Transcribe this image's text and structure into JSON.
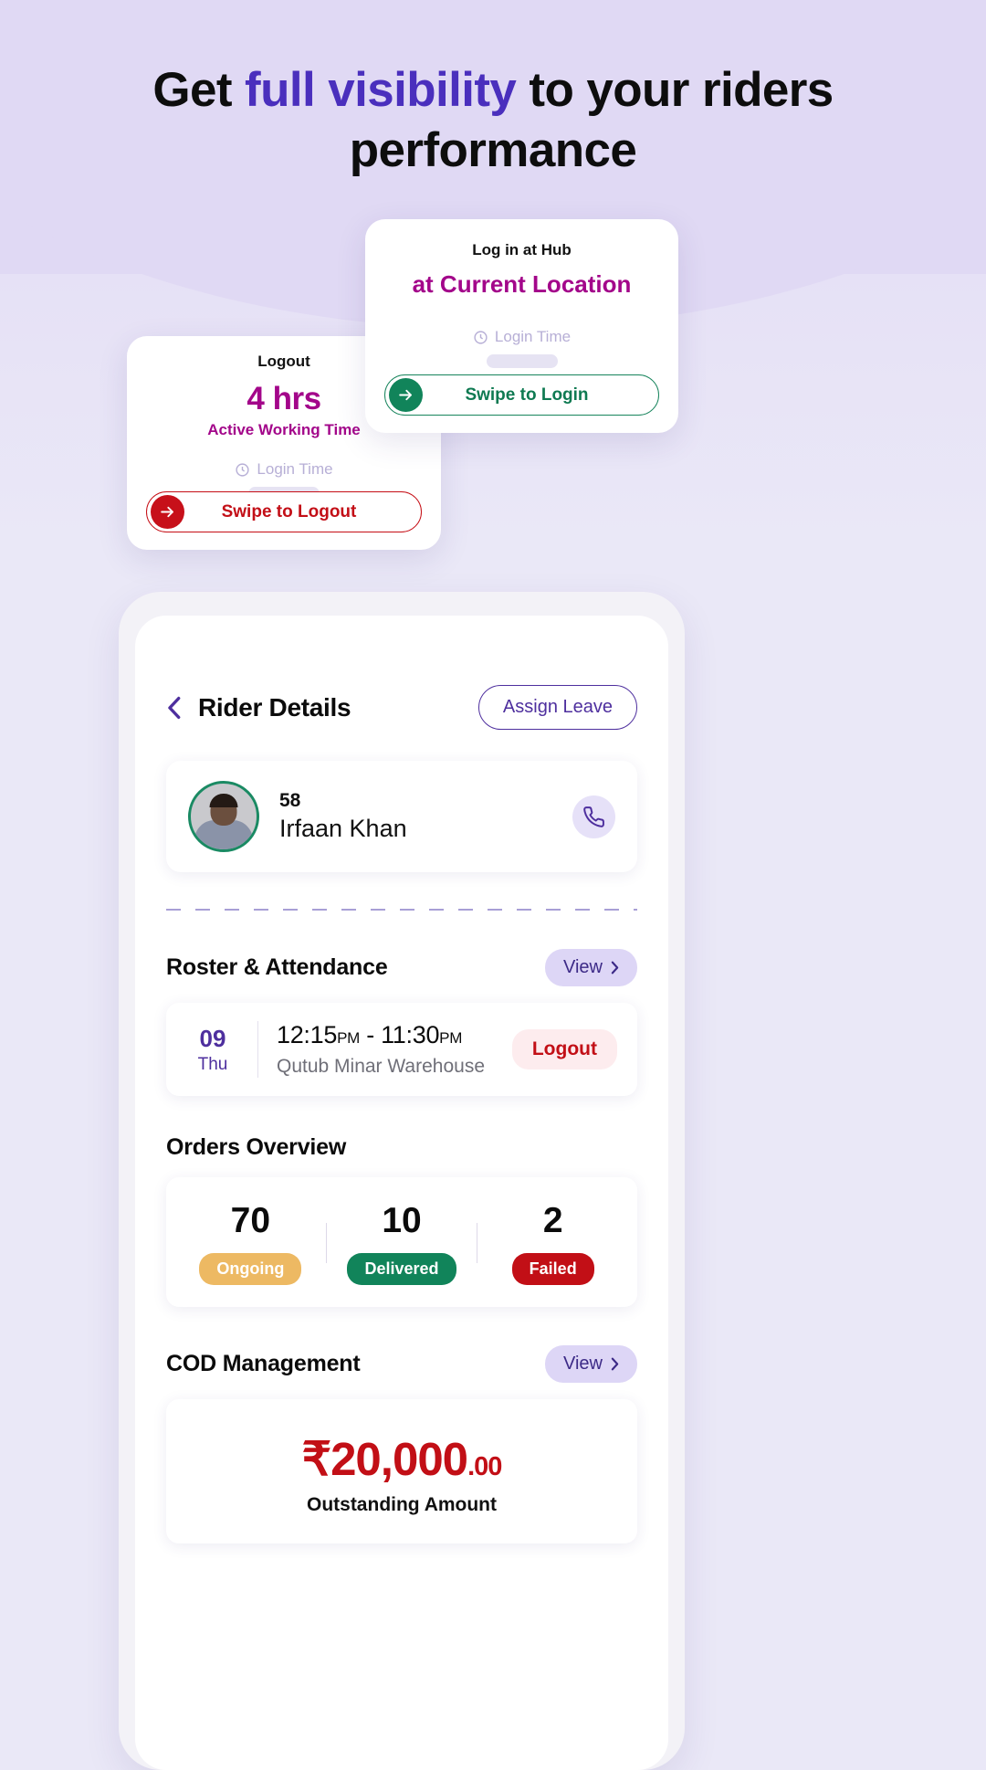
{
  "headline": {
    "pre": "Get ",
    "highlight": "full visibility",
    "post": " to your riders performance"
  },
  "login_card": {
    "title": "Log in at Hub",
    "subtitle": "at Current Location",
    "login_time_label": "Login Time",
    "clock_icon": "clock-icon",
    "swipe_label": "Swipe to Login",
    "arrow_icon": "arrow-right-icon",
    "accent": "#11845a"
  },
  "logout_card": {
    "title": "Logout",
    "hours": "4 hrs",
    "subtitle": "Active Working Time",
    "login_time_label": "Login Time",
    "clock_icon": "clock-icon",
    "swipe_label": "Swipe to Logout",
    "arrow_icon": "arrow-right-icon",
    "accent": "#c7101a"
  },
  "app": {
    "back_icon": "chevron-left-icon",
    "title": "Rider Details",
    "assign_leave_label": "Assign Leave",
    "accent": "#4e2f9e",
    "rider": {
      "avatar": "rider-avatar",
      "id": "58",
      "name": "Irfaan Khan",
      "call_icon": "phone-icon"
    },
    "roster": {
      "title": "Roster & Attendance",
      "view_label": "View",
      "chevron_icon": "chevron-right-icon",
      "shift": {
        "day": "09",
        "weekday": "Thu",
        "start_time": "12:15",
        "start_ampm": "PM",
        "dash": "-",
        "end_time": "11:30",
        "end_ampm": "PM",
        "location": "Qutub Minar Warehouse",
        "status": "Logout"
      }
    },
    "orders": {
      "title": "Orders Overview",
      "items": [
        {
          "count": "70",
          "label": "Ongoing",
          "color": "#edb963"
        },
        {
          "count": "10",
          "label": "Delivered",
          "color": "#11845a"
        },
        {
          "count": "2",
          "label": "Failed",
          "color": "#c20f16"
        }
      ]
    },
    "cod": {
      "title": "COD Management",
      "view_label": "View",
      "chevron_icon": "chevron-right-icon",
      "currency": "₹",
      "amount": "20,000",
      "paise": ".00",
      "label": "Outstanding Amount"
    }
  }
}
